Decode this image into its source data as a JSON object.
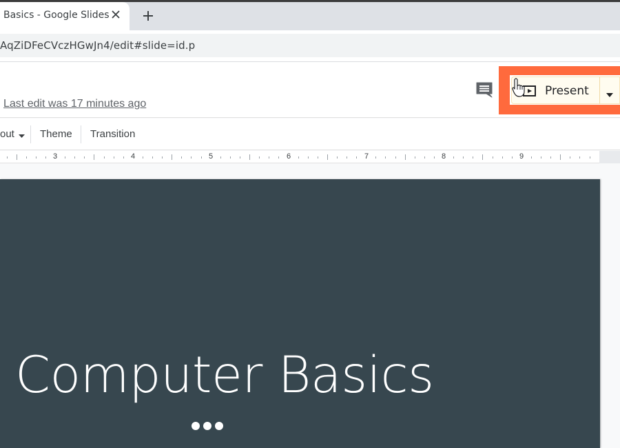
{
  "browser": {
    "tab_title": "Basics - Google Slides",
    "url": "AqZiDFeCVczHGwJn4/edit#slide=id.p",
    "close_icon": "close-icon",
    "new_tab_icon": "plus-icon"
  },
  "header": {
    "last_edit": "Last edit was 17 minutes ago",
    "comment_icon": "comment-icon",
    "present_label": "Present",
    "present_icon": "present-slideshow-icon",
    "present_dropdown_icon": "caret-down-icon",
    "highlight_color": "#ff6a3d"
  },
  "toolbar": {
    "layout_label": "out",
    "theme_label": "Theme",
    "transition_label": "Transition"
  },
  "ruler": {
    "numbers": [
      "3",
      "4",
      "5",
      "6",
      "7",
      "8",
      "9"
    ]
  },
  "slide": {
    "title": "Computer Basics",
    "background_color": "#37474f",
    "ornament": "three-dots"
  }
}
